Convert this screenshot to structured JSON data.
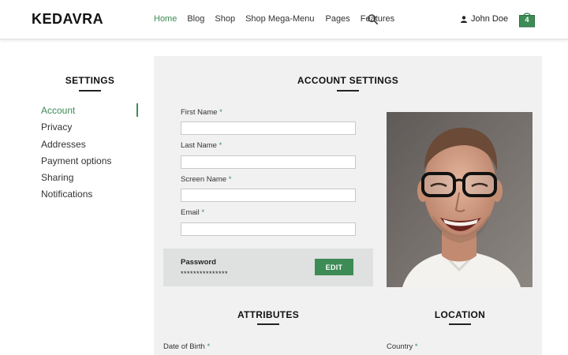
{
  "header": {
    "logo": "KEDAVRA",
    "nav": [
      "Home",
      "Blog",
      "Shop",
      "Shop Mega-Menu",
      "Pages",
      "Features"
    ],
    "active_nav": "Home",
    "user_name": "John Doe",
    "cart_count": "4",
    "icons": {
      "search": "search-icon",
      "user": "user-icon",
      "cart": "shopping-bag-icon"
    }
  },
  "sidebar": {
    "title": "SETTINGS",
    "items": [
      "Account",
      "Privacy",
      "Addresses",
      "Payment options",
      "Sharing",
      "Notifications"
    ],
    "active_item": "Account"
  },
  "account": {
    "title": "ACCOUNT SETTINGS",
    "fields": [
      {
        "label": "First Name",
        "required": "*",
        "value": ""
      },
      {
        "label": "Last Name",
        "required": "*",
        "value": ""
      },
      {
        "label": "Screen Name",
        "required": "*",
        "value": ""
      },
      {
        "label": "Email",
        "required": "*",
        "value": ""
      }
    ],
    "password_label": "Password",
    "password_value": "***************",
    "edit_label": "EDIT",
    "photo": "profile-photo"
  },
  "attributes": {
    "title": "ATTRIBUTES",
    "field_label": "Date of Birth",
    "required": "*"
  },
  "location": {
    "title": "LOCATION",
    "field_label": "Country",
    "required": "*"
  },
  "colors": {
    "accent": "#3d8b55",
    "panel_bg": "#f1f1f1",
    "password_bg": "#dfe0e0"
  }
}
